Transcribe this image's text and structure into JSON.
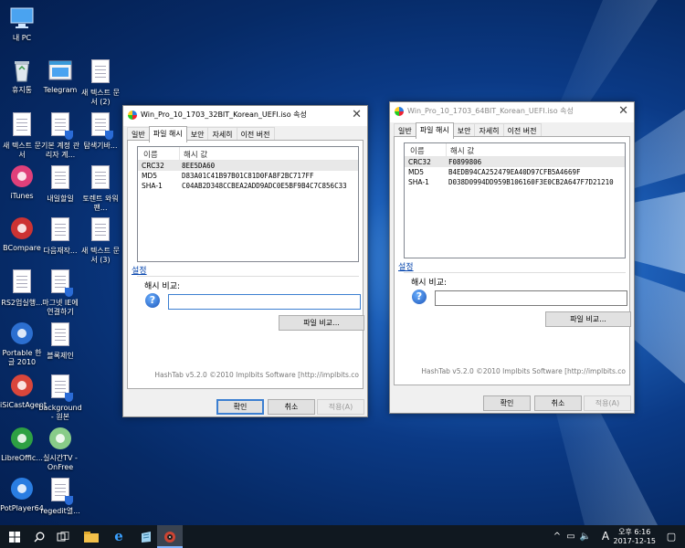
{
  "desktop": {
    "icons": [
      {
        "label": "내 PC",
        "icon": "computer-icon"
      },
      {
        "label": "휴지통",
        "icon": "recycle-bin-icon"
      },
      {
        "label": "Telegram",
        "icon": "telegram-icon"
      },
      {
        "label": "새 텍스트 문서 (2)",
        "icon": "text-document-icon"
      },
      {
        "label": "새 텍스트 문서",
        "icon": "text-document-icon"
      },
      {
        "label": "기본 계정 관리자 계...",
        "icon": "shortcut-icon"
      },
      {
        "label": "탐색기바...",
        "icon": "shortcut-icon"
      },
      {
        "label": "iTunes",
        "icon": "itunes-icon"
      },
      {
        "label": "내일할일",
        "icon": "text-document-icon"
      },
      {
        "label": "토렌트 와워팬...",
        "icon": "text-document-icon"
      },
      {
        "label": "BCompare",
        "icon": "bcompare-icon"
      },
      {
        "label": "다음재작...",
        "icon": "text-document-icon"
      },
      {
        "label": "새 텍스트 문서 (3)",
        "icon": "text-document-icon"
      },
      {
        "label": "RS2업실행...",
        "icon": "text-document-icon"
      },
      {
        "label": "마그넷 IE에 연결하기",
        "icon": "shortcut-icon"
      },
      {
        "label": "Portable 한글 2010",
        "icon": "hangul-icon"
      },
      {
        "label": "블록제인",
        "icon": "text-document-icon"
      },
      {
        "label": "iSiCastAgent",
        "icon": "isicast-icon"
      },
      {
        "label": "background - 원본",
        "icon": "shortcut-icon"
      },
      {
        "label": "LibreOffic...",
        "icon": "libreoffice-icon"
      },
      {
        "label": "실시간TV - OnFree",
        "icon": "tv-icon"
      },
      {
        "label": "PotPlayer64",
        "icon": "potplayer-icon"
      },
      {
        "label": "regedit열...",
        "icon": "shortcut-icon"
      }
    ]
  },
  "windows": [
    {
      "title": "Win_Pro_10_1703_32BIT_Korean_UEFI.iso 속성",
      "active": true,
      "tabs": [
        "일반",
        "파일 해시",
        "보안",
        "자세히",
        "이전 버전"
      ],
      "columns": [
        "이름",
        "해시 값"
      ],
      "rows": [
        {
          "name": "CRC32",
          "value": "8EE5DA60"
        },
        {
          "name": "MD5",
          "value": "D83A01C41B97B01C81D0FA8F2BC717FF"
        },
        {
          "name": "SHA-1",
          "value": "C04AB2D348CCBEA2ADD9ADC0E5BF9B4C7C856C33"
        }
      ],
      "settings": "설정",
      "compare_label": "해시 비교:",
      "compare_file": "파일 비교...",
      "footer": "HashTab v5.2.0 ©2010 Implbits Software [http://implbits.co",
      "ok": "확인",
      "cancel": "취소",
      "apply": "적용(A)"
    },
    {
      "title": "Win_Pro_10_1703_64BIT_Korean_UEFI.iso 속성",
      "active": false,
      "tabs": [
        "일반",
        "파일 해시",
        "보안",
        "자세히",
        "이전 버전"
      ],
      "columns": [
        "이름",
        "해시 값"
      ],
      "rows": [
        {
          "name": "CRC32",
          "value": "F0899806"
        },
        {
          "name": "MD5",
          "value": "B4EDB94CA252479EA40D97CFB5A4669F"
        },
        {
          "name": "SHA-1",
          "value": "D038D0994DD959B106160F3E0CB2A647F7D21210"
        }
      ],
      "settings": "설정",
      "compare_label": "해시 비교:",
      "compare_file": "파일 비교...",
      "footer": "HashTab v5.2.0 ©2010 Implbits Software [http://implbits.co",
      "ok": "확인",
      "cancel": "취소",
      "apply": "적용(A)"
    }
  ],
  "taskbar": {
    "tray_ime": "A",
    "time": "오후 6:16",
    "date": "2017-12-15"
  }
}
